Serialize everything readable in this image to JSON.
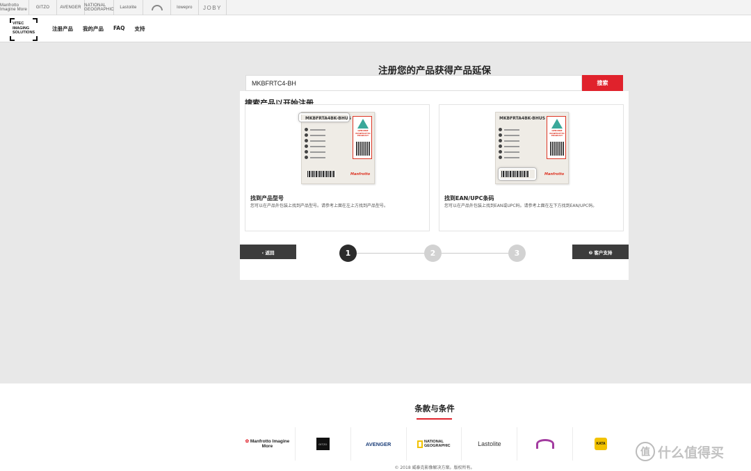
{
  "brand_strip": [
    {
      "name": "Manfrotto Imagine More",
      "width": 42
    },
    {
      "name": "GITZO",
      "width": 40
    },
    {
      "name": "AVENGER",
      "width": 40
    },
    {
      "name": "NATIONAL GEOGRAPHIC",
      "width": 42
    },
    {
      "name": "Lastolite",
      "width": 42
    },
    {
      "name": "",
      "width": 40
    },
    {
      "name": "lowepro",
      "width": 40
    },
    {
      "name": "JOBY",
      "width": 40
    }
  ],
  "header": {
    "logo_text": [
      "VITEC",
      "IMAGING",
      "SOLUTIONS"
    ],
    "nav": [
      "注册产品",
      "我的产品",
      "FAQ",
      "支持"
    ]
  },
  "main": {
    "title": "注册您的产品获得产品延保",
    "card_title": "搜索产品以开始注册",
    "search_value": "MKBFRTC4-BH",
    "search_button": "搜索",
    "info_left": {
      "label_code": "MKBFRTA4BK-BHUS",
      "title": "找到产品型号",
      "desc": "您可以在产品外包装上找到产品型号。请参考上面在左上方找到产品型号。"
    },
    "info_right": {
      "label_code": "MKBFRTA4BK-BHUS",
      "title": "找到EAN/UPC条码",
      "desc": "您可以在产品外包装上找到EAN或UPC码。请参考上面在左下方找到EAN/UPC码。"
    },
    "label_genuine": "GENUINE MANFROTTO PRODUCT",
    "label_brand": "Manfrotto",
    "back_button": "‹ 返回",
    "support_button": "❷ 客户支持",
    "steps": [
      "1",
      "2",
      "3"
    ],
    "current_step": 1
  },
  "footer": {
    "title": "条款与条件",
    "logos": [
      "Manfrotto Imagine More",
      "GITZO",
      "AVENGER",
      "NATIONAL GEOGRAPHIC",
      "Lastolite",
      "lowepro",
      "KATA"
    ],
    "copyright": "© 2018 威泰克影像解决方案。版权所有。"
  },
  "watermark": "什么值得买",
  "colors": {
    "accent_red": "#e0222c",
    "dark_button": "#3c3c3c",
    "gray_bg": "#e8e8e8"
  }
}
